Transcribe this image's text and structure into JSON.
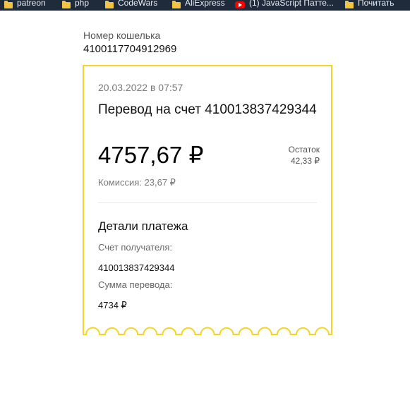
{
  "bookmarks": [
    {
      "label": "patreon",
      "icon": "folder-icon"
    },
    {
      "label": "php",
      "icon": "folder-icon"
    },
    {
      "label": "CodeWars",
      "icon": "folder-icon"
    },
    {
      "label": "AliExpress",
      "icon": "folder-icon"
    },
    {
      "label": "(1) JavaScript Патте...",
      "icon": "youtube-icon"
    },
    {
      "label": "Почитать",
      "icon": "folder-icon"
    }
  ],
  "wallet": {
    "label": "Номер кошелька",
    "number": "4100117704912969"
  },
  "receipt": {
    "date": "20.03.2022 в 07:57",
    "title": "Перевод на счет 410013837429344",
    "amount": "4757,67 ₽",
    "balance_label": "Остаток",
    "balance_value": "42,33 ₽",
    "commission": "Комиссия: 23,67 ₽",
    "details_heading": "Детали платежа",
    "recipient_label": "Счет получателя:",
    "recipient_value": "410013837429344",
    "sum_label": "Сумма перевода:",
    "sum_value": "4734 ₽"
  },
  "colors": {
    "accent": "#f5d327",
    "bookmarks_bar": "#1f2a3a"
  }
}
